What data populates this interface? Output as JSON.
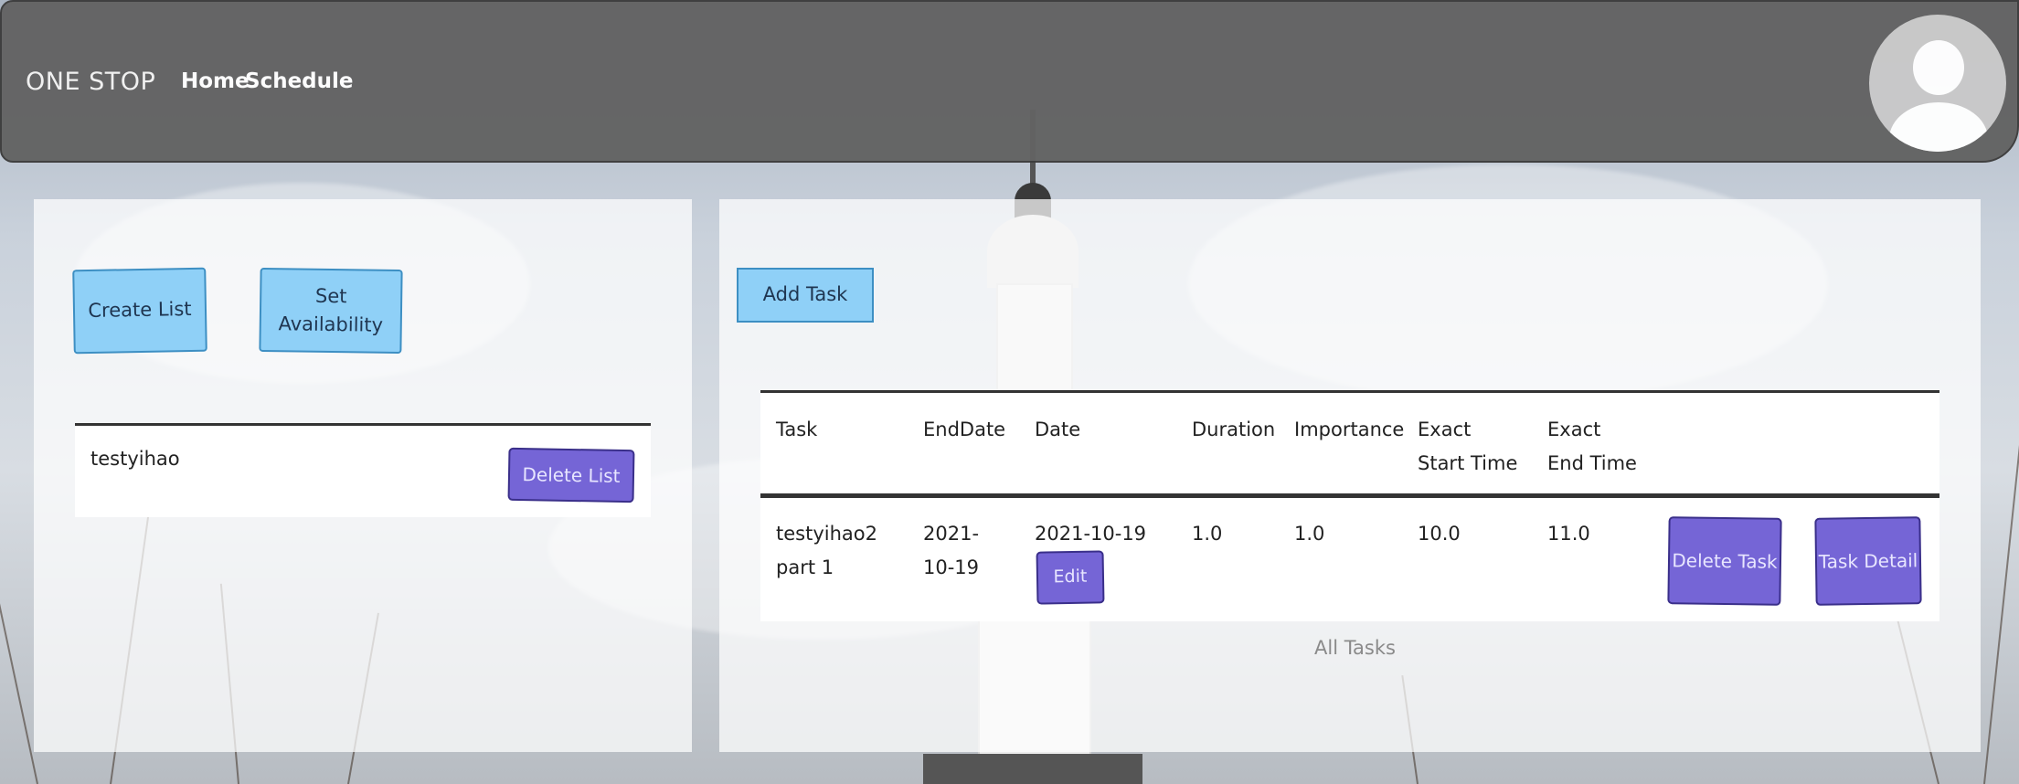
{
  "nav": {
    "brand": "ONE STOP",
    "links": [
      "Home",
      "Schedule"
    ]
  },
  "left": {
    "create_list": "Create List",
    "set_availability": "Set Availability",
    "lists": [
      {
        "name": "testyihao",
        "delete_label": "Delete List"
      }
    ]
  },
  "right": {
    "add_task": "Add Task",
    "table": {
      "headers": [
        "Task",
        "EndDate",
        "Date",
        "Duration",
        "Importance",
        "Exact Start Time",
        "Exact End Time"
      ],
      "rows": [
        {
          "task": "testyihao2 part 1",
          "end_date": "2021-10-19",
          "date": "2021-10-19",
          "edit": "Edit",
          "duration": "1.0",
          "importance": "1.0",
          "start": "10.0",
          "end": "11.0",
          "delete": "Delete Task",
          "detail": "Task Detail"
        }
      ]
    },
    "footer": "All Tasks"
  },
  "colors": {
    "nav_bg": "#636363",
    "blue_button": "#8fd0f7",
    "purple_button": "#7565d6"
  }
}
